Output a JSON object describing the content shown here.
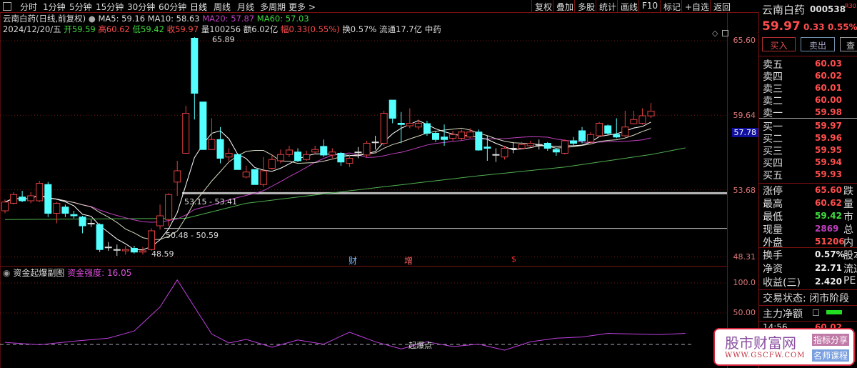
{
  "toolbar": {
    "tabs": [
      "分时",
      "1分钟",
      "5分钟",
      "15分钟",
      "30分钟",
      "60分钟",
      "日线",
      "周线",
      "月线",
      "多周期",
      "更多 >"
    ],
    "active": "日线",
    "right": [
      "复权",
      "叠加",
      "多股",
      "统计",
      "画线",
      "F10",
      "标记",
      "+自选",
      "返回"
    ]
  },
  "info": {
    "title": "云南白药(日线,前复权)",
    "ma5": "MA5: 59.16",
    "ma10": "MA10: 58.63",
    "ma20": "MA20: 57.87",
    "ma60": "MA60: 57.03",
    "date": "2024/12/20/五",
    "open": "开59.59",
    "high": "高60.62",
    "low": "低59.42",
    "close": "收59.97",
    "vol": "量100256",
    "amount": "额6.02亿",
    "range": "幅0.33(0.55%)",
    "turnover": "换0.57%",
    "float": "流通17.7亿",
    "sector": "中药"
  },
  "axis": {
    "price": [
      "65.60",
      "59.64",
      "53.68",
      "48.31"
    ],
    "current": "57.78",
    "sub": [
      "100.0",
      "50.00"
    ]
  },
  "annotations": {
    "high": "65.89",
    "low": "48.59",
    "zone1": "53.15 - 53.41",
    "zone2": "50.48 - 50.59",
    "m1": "财",
    "m2": "增",
    "m3": "$"
  },
  "sub": {
    "name": "资金起爆副图",
    "strength": "资金强度: 16.05",
    "threshold": "起爆点"
  },
  "colors": {
    "up": "#e04040",
    "down": "#54ffff",
    "ma5": "#ffffff",
    "ma10": "#d8d8c0",
    "ma20": "#c040c0",
    "ma60": "#50b050",
    "strength": "#c040e0"
  },
  "chart_data": {
    "type": "candlestick",
    "ylim": [
      48.31,
      65.6
    ],
    "candles": [
      [
        52.0,
        52.7,
        52.9,
        51.8
      ],
      [
        52.6,
        53.3,
        53.5,
        52.5
      ],
      [
        53.1,
        52.8,
        53.6,
        52.7
      ],
      [
        52.8,
        53.2,
        53.5,
        52.6
      ],
      [
        52.8,
        54.2,
        54.4,
        52.7
      ],
      [
        54.1,
        51.8,
        54.3,
        51.5
      ],
      [
        51.8,
        52.6,
        52.7,
        51.0
      ],
      [
        52.3,
        51.8,
        52.5,
        51.5
      ],
      [
        51.7,
        51.6,
        52.0,
        51.4
      ],
      [
        51.5,
        50.8,
        51.6,
        50.2
      ],
      [
        51.0,
        51.0,
        51.3,
        50.7
      ],
      [
        50.9,
        48.9,
        51.0,
        48.7
      ],
      [
        49.1,
        49.1,
        49.5,
        48.8
      ],
      [
        48.9,
        48.9,
        49.3,
        48.4
      ],
      [
        48.8,
        48.9,
        49.2,
        48.5
      ],
      [
        49.0,
        48.7,
        49.2,
        48.59
      ],
      [
        48.7,
        48.8,
        49.1,
        48.5
      ],
      [
        48.9,
        50.4,
        50.6,
        48.8
      ],
      [
        50.8,
        51.6,
        52.5,
        50.5
      ],
      [
        51.3,
        53.3,
        53.4,
        50.8
      ],
      [
        54.3,
        55.2,
        56.0,
        53.2
      ],
      [
        56.6,
        59.8,
        60.4,
        56.6
      ],
      [
        65.8,
        61.4,
        65.89,
        59.3
      ],
      [
        60.7,
        56.9,
        60.7,
        56.9
      ],
      [
        56.9,
        57.7,
        59.4,
        56.9
      ],
      [
        57.7,
        56.2,
        58.7,
        55.8
      ],
      [
        56.3,
        56.6,
        57.0,
        56.0
      ],
      [
        56.5,
        55.3,
        56.5,
        55.3
      ],
      [
        54.7,
        55.1,
        55.6,
        54.6
      ],
      [
        55.3,
        54.1,
        55.3,
        54.1
      ],
      [
        54.1,
        55.2,
        56.3,
        53.9
      ],
      [
        55.4,
        56.1,
        56.5,
        55.3
      ],
      [
        56.0,
        56.5,
        56.9,
        55.8
      ],
      [
        56.5,
        56.86,
        57.2,
        56.3
      ],
      [
        56.7,
        56.0,
        57.0,
        55.9
      ],
      [
        56.1,
        56.5,
        56.8,
        56.0
      ],
      [
        56.7,
        56.9,
        57.2,
        56.5
      ],
      [
        57.15,
        56.46,
        57.7,
        56.3
      ],
      [
        56.46,
        56.7,
        57.0,
        56.2
      ],
      [
        56.6,
        55.9,
        56.7,
        55.6
      ],
      [
        55.8,
        56.2,
        56.5,
        55.5
      ],
      [
        56.7,
        56.7,
        57.1,
        56.2
      ],
      [
        56.46,
        57.4,
        57.6,
        56.3
      ],
      [
        57.5,
        57.5,
        58.0,
        56.9
      ],
      [
        57.4,
        59.8,
        60.0,
        57.2
      ],
      [
        60.85,
        59.4,
        60.85,
        59.0
      ],
      [
        59.0,
        58.9,
        59.9,
        57.4
      ],
      [
        58.8,
        59.0,
        60.2,
        58.6
      ],
      [
        58.7,
        59.0,
        59.3,
        58.5
      ],
      [
        58.97,
        58.2,
        59.2,
        58.0
      ],
      [
        58.2,
        57.7,
        58.4,
        57.5
      ],
      [
        57.9,
        57.7,
        58.9,
        57.2
      ],
      [
        57.8,
        58.1,
        58.4,
        57.6
      ],
      [
        57.8,
        58.3,
        58.5,
        57.6
      ],
      [
        57.9,
        58.3,
        58.6,
        57.8
      ],
      [
        58.3,
        56.86,
        58.5,
        56.8
      ],
      [
        57.1,
        57.0,
        58.0,
        56.0
      ],
      [
        56.5,
        56.5,
        57.0,
        55.9
      ],
      [
        56.3,
        57.0,
        57.2,
        56.1
      ],
      [
        57.0,
        57.0,
        57.5,
        56.6
      ],
      [
        57.0,
        57.3,
        57.5,
        56.9
      ],
      [
        57.2,
        57.4,
        57.6,
        57.1
      ],
      [
        57.3,
        57.3,
        57.7,
        56.9
      ],
      [
        57.4,
        57.0,
        57.5,
        56.8
      ],
      [
        56.9,
        56.7,
        57.0,
        56.4
      ],
      [
        56.6,
        57.6,
        57.7,
        56.5
      ],
      [
        57.6,
        57.4,
        57.9,
        57.2
      ],
      [
        58.4,
        57.6,
        58.7,
        57.4
      ],
      [
        57.5,
        58.1,
        58.3,
        57.4
      ],
      [
        58.0,
        59.0,
        59.1,
        57.9
      ],
      [
        58.8,
        58.2,
        58.9,
        58.1
      ],
      [
        58.1,
        57.9,
        59.4,
        57.8
      ],
      [
        58.0,
        58.7,
        60.0,
        57.9
      ],
      [
        58.97,
        59.3,
        60.0,
        58.9
      ],
      [
        59.0,
        59.6,
        60.2,
        58.9
      ],
      [
        59.59,
        59.97,
        60.62,
        59.42
      ]
    ],
    "ma60": [
      [
        0,
        51.3
      ],
      [
        21,
        51.4
      ],
      [
        28,
        52.6
      ],
      [
        40,
        53.6
      ],
      [
        55,
        54.8
      ],
      [
        65,
        55.5
      ],
      [
        75,
        56.5
      ],
      [
        79,
        57.03
      ]
    ],
    "strength": [
      [
        0,
        1
      ],
      [
        4,
        -3
      ],
      [
        8,
        3
      ],
      [
        12,
        8
      ],
      [
        15,
        20
      ],
      [
        18,
        60
      ],
      [
        20,
        105
      ],
      [
        22,
        60
      ],
      [
        24,
        15
      ],
      [
        26,
        0
      ],
      [
        28,
        6
      ],
      [
        31,
        -7
      ],
      [
        34,
        5
      ],
      [
        37,
        -2
      ],
      [
        40,
        18
      ],
      [
        43,
        2
      ],
      [
        46,
        -10
      ],
      [
        49,
        2
      ],
      [
        52,
        -6
      ],
      [
        55,
        -2
      ],
      [
        58,
        -12
      ],
      [
        61,
        2
      ],
      [
        64,
        8
      ],
      [
        67,
        10
      ],
      [
        70,
        16
      ],
      [
        73,
        15
      ],
      [
        76,
        14
      ],
      [
        79,
        16.05
      ]
    ]
  },
  "panel": {
    "name": "云南白药",
    "code": "000538",
    "tag": "R30",
    "price": "59.97",
    "change": "0.33",
    "pct": "0.55%",
    "buy": "买入",
    "sell": "卖出",
    "query": "查",
    "asks": [
      [
        "卖五",
        "60.03"
      ],
      [
        "卖四",
        "60.02"
      ],
      [
        "卖三",
        "60.01"
      ],
      [
        "卖二",
        "60.00"
      ],
      [
        "卖一",
        "59.98"
      ]
    ],
    "bids": [
      [
        "买一",
        "59.97"
      ],
      [
        "买二",
        "59.96"
      ],
      [
        "买三",
        "59.95"
      ],
      [
        "买四",
        "59.94"
      ],
      [
        "买五",
        "59.93"
      ]
    ],
    "stats": [
      [
        "涨停",
        "65.60",
        "跌"
      ],
      [
        "最高",
        "60.62",
        "量"
      ],
      [
        "最低",
        "59.42",
        "市"
      ],
      [
        "现量",
        "2869",
        "总"
      ],
      [
        "外盘",
        "51206",
        "内"
      ]
    ],
    "stats2": [
      [
        "换手",
        "0.57%",
        "股本"
      ],
      [
        "净资",
        "22.71",
        "流通"
      ],
      [
        "收益(三)",
        "2.420",
        "PE"
      ]
    ],
    "status": "交易状态: 闭市阶段",
    "main_net": "主力净额",
    "tick": [
      "14:56",
      "60.02"
    ]
  },
  "watermark": {
    "name": "股市财富网",
    "url": "WWW.GSCFW.COM",
    "tag1": "指标分享",
    "tag2": "名师课程"
  }
}
